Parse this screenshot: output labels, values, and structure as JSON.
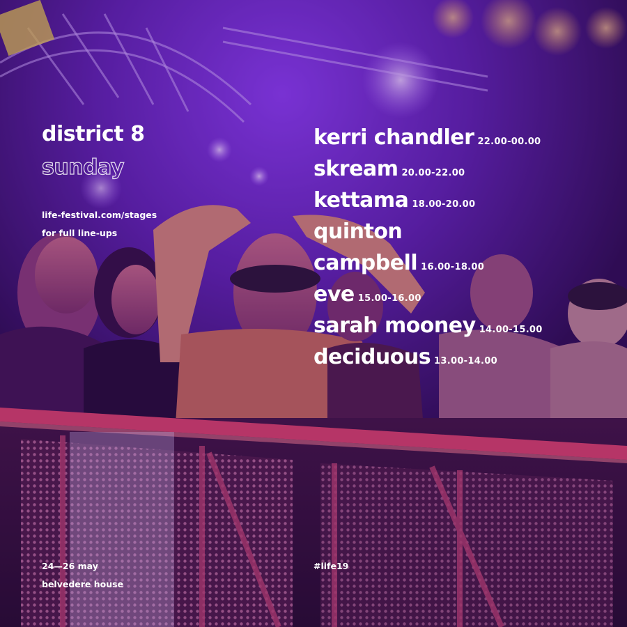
{
  "stage": {
    "name": "district 8",
    "day": "sunday"
  },
  "info": {
    "url": "life-festival.com/stages",
    "note": "for full line-ups"
  },
  "lineup": [
    {
      "name": "kerri chandler",
      "time": "22.00-00.00"
    },
    {
      "name": "skream",
      "time": "20.00-22.00"
    },
    {
      "name": "kettama",
      "time": "18.00-20.00"
    },
    {
      "name": "quinton",
      "time": ""
    },
    {
      "name": "campbell",
      "time": "16.00-18.00"
    },
    {
      "name": "eve",
      "time": "15.00-16.00"
    },
    {
      "name": "sarah mooney",
      "time": "14.00-15.00"
    },
    {
      "name": "deciduous",
      "time": "13.00-14.00"
    }
  ],
  "footer": {
    "dates": "24—26 may",
    "venue": "belvedere house",
    "hashtag": "#life19"
  },
  "colors": {
    "background": "#2a0a4a",
    "accent_purple": "#7b2fd6",
    "barrier_red": "#e0405a",
    "text": "#ffffff"
  }
}
